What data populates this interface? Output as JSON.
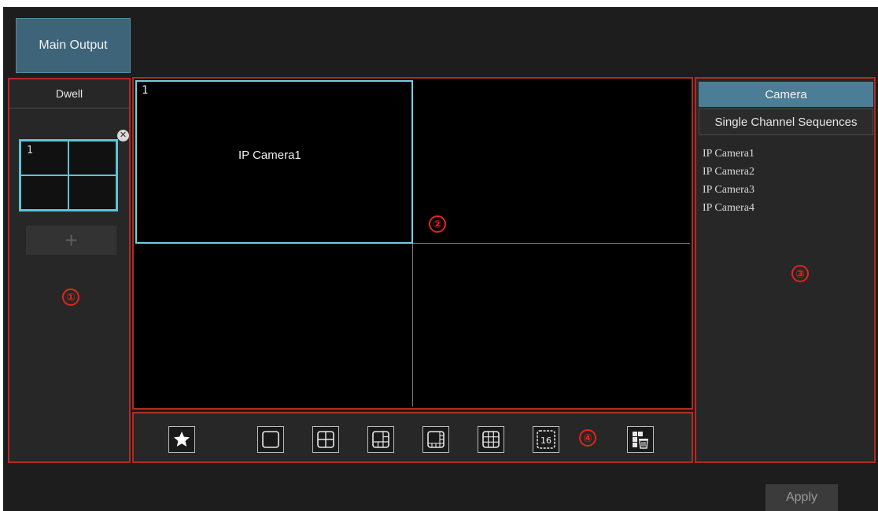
{
  "header": {
    "main_output_label": "Main Output"
  },
  "dwell_panel": {
    "title": "Dwell",
    "thumb_cell_number": "1",
    "close_icon": "x-circle-icon",
    "add_label": "+",
    "marker": "①"
  },
  "video": {
    "active_cell_number": "1",
    "camera_label": "IP Camera1",
    "marker": "②"
  },
  "camera_panel": {
    "tab_camera": "Camera",
    "tab_sequences": "Single Channel Sequences",
    "cameras": [
      "IP Camera1",
      "IP Camera2",
      "IP Camera3",
      "IP Camera4"
    ],
    "marker": "③"
  },
  "toolbar": {
    "buttons": [
      "star-icon",
      "layout-1-icon",
      "layout-4-icon",
      "layout-6-icon",
      "layout-8-icon",
      "layout-9-icon",
      "layout-16-icon",
      "clear-layout-icon"
    ],
    "layout16_text": "16",
    "marker": "④"
  },
  "footer": {
    "apply_label": "Apply"
  },
  "colors": {
    "accent": "#4c7d96",
    "highlight": "#6ed0e3",
    "annotation": "#e2251b"
  }
}
